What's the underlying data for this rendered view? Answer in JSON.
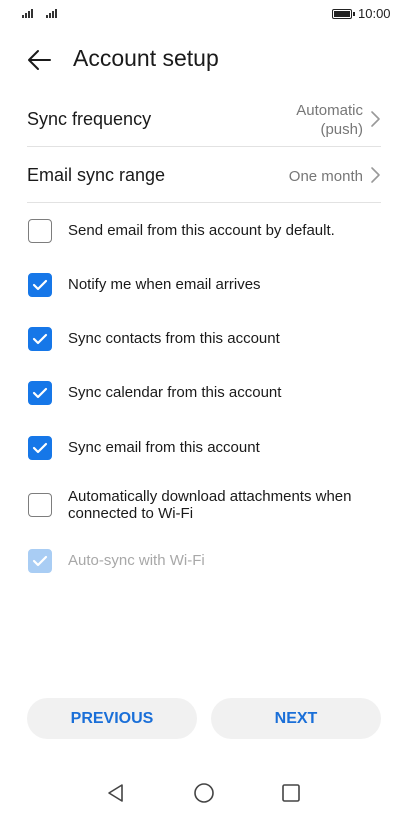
{
  "status_bar": {
    "time": "10:00"
  },
  "header": {
    "title": "Account setup"
  },
  "settings": {
    "sync_frequency": {
      "label": "Sync frequency",
      "value_line1": "Automatic",
      "value_line2": "(push)"
    },
    "email_sync_range": {
      "label": "Email sync range",
      "value": "One month"
    }
  },
  "options": [
    {
      "label": "Send email from this account by default.",
      "checked": false,
      "enabled": true
    },
    {
      "label": "Notify me when email arrives",
      "checked": true,
      "enabled": true
    },
    {
      "label": "Sync contacts from this account",
      "checked": true,
      "enabled": true
    },
    {
      "label": "Sync calendar from this account",
      "checked": true,
      "enabled": true
    },
    {
      "label": "Sync email from this account",
      "checked": true,
      "enabled": true
    },
    {
      "label_line1": "Automatically download attachments when",
      "label_line2": "connected to Wi-Fi",
      "checked": false,
      "enabled": true
    },
    {
      "label": "Auto-sync with Wi-Fi",
      "checked": true,
      "enabled": false
    }
  ],
  "buttons": {
    "previous": "PREVIOUS",
    "next": "NEXT"
  },
  "colors": {
    "accent": "#1677e8",
    "button_text": "#1a6fd8",
    "disabled_check": "#a9cdf4"
  },
  "icons": {
    "back": "arrow-left-icon",
    "chevron": "chevron-right-icon",
    "nav_back": "triangle-back-icon",
    "nav_home": "circle-home-icon",
    "nav_recents": "square-recents-icon"
  }
}
